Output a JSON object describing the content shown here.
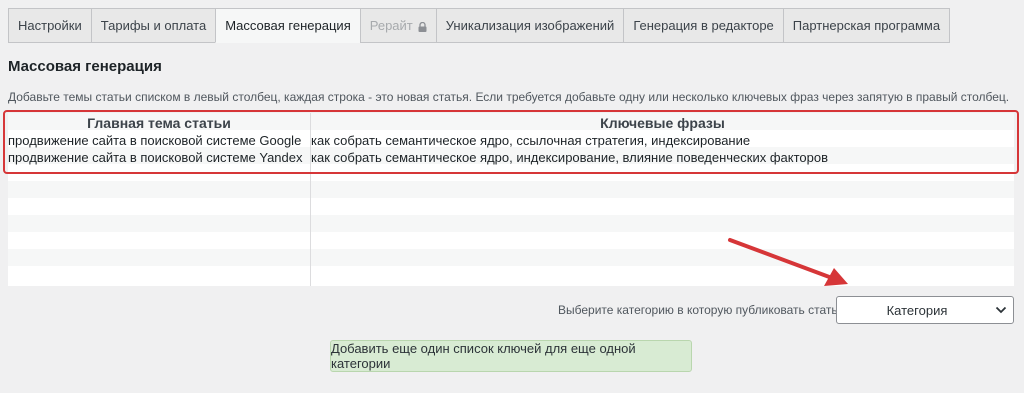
{
  "tabs": [
    {
      "label": "Настройки",
      "state": "normal"
    },
    {
      "label": "Тарифы и оплата",
      "state": "normal"
    },
    {
      "label": "Массовая генерация",
      "state": "active"
    },
    {
      "label": "Рерайт",
      "state": "disabled"
    },
    {
      "label": "Уникализация изображений",
      "state": "normal"
    },
    {
      "label": "Генерация в редакторе",
      "state": "normal"
    },
    {
      "label": "Партнерская программа",
      "state": "normal"
    }
  ],
  "section": {
    "title": "Массовая генерация",
    "description": "Добавьте темы статьи списком в левый столбец, каждая строка - это новая статья. Если требуется добавьте одну или несколько ключевых фраз через запятую в правый столбец."
  },
  "grid": {
    "headers": [
      "Главная тема статьи",
      "Ключевые фразы"
    ],
    "rows": [
      {
        "topic": "продвижение сайта в поисковой системе Google",
        "keywords": "как собрать семантическое ядро, ссылочная стратегия, индексирование"
      },
      {
        "topic": "продвижение сайта в поисковой системе Yandex",
        "keywords": "как собрать семантическое ядро, индексирование, влияние поведенческих факторов"
      }
    ]
  },
  "category": {
    "label": "Выберите категорию в которую публиковать статьи",
    "selected": "Категория"
  },
  "add_button": "Добавить еще один список ключей для еще одной категории",
  "colors": {
    "highlight": "#d63638",
    "button_bg": "#d8ebd3"
  },
  "icons": {
    "tab_lock": "lock-icon",
    "select_chevron": "chevron-down-icon",
    "annotation_arrow": "arrow-icon"
  }
}
